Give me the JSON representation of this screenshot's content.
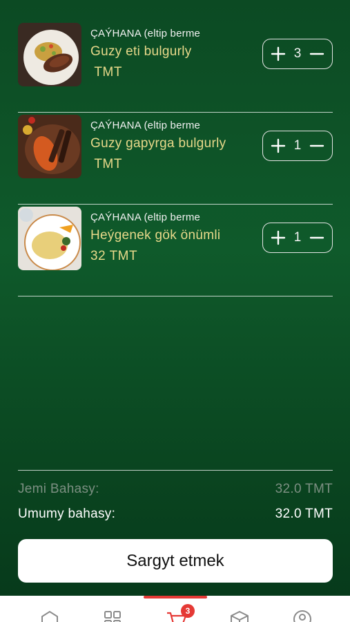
{
  "cart": {
    "items": [
      {
        "shop": "ÇAÝHANA (eltip berme",
        "name": "Guzy eti bulgurly",
        "price": " TMT",
        "qty": "3"
      },
      {
        "shop": "ÇAÝHANA (eltip berme",
        "name": "Guzy gapyrga bulgurly",
        "price": " TMT",
        "qty": "1"
      },
      {
        "shop": "ÇAÝHANA (eltip berme",
        "name": "Heýgenek gök önümli",
        "price": "32 TMT",
        "qty": "1"
      }
    ]
  },
  "summary": {
    "subtotal_label": "Jemi Bahasy:",
    "subtotal_value": "32.0 TMT",
    "total_label": "Umumy bahasy:",
    "total_value": "32.0 TMT"
  },
  "order_button": "Sargyt etmek",
  "tabbar": {
    "cart_badge": "3",
    "tabs": [
      "home-icon",
      "grid-icon",
      "cart-icon",
      "box-icon",
      "profile-icon"
    ],
    "active_tab": "cart-icon"
  },
  "colors": {
    "background": "#0f5a2b",
    "accent_text": "#e8d98a",
    "active": "#e53935"
  }
}
